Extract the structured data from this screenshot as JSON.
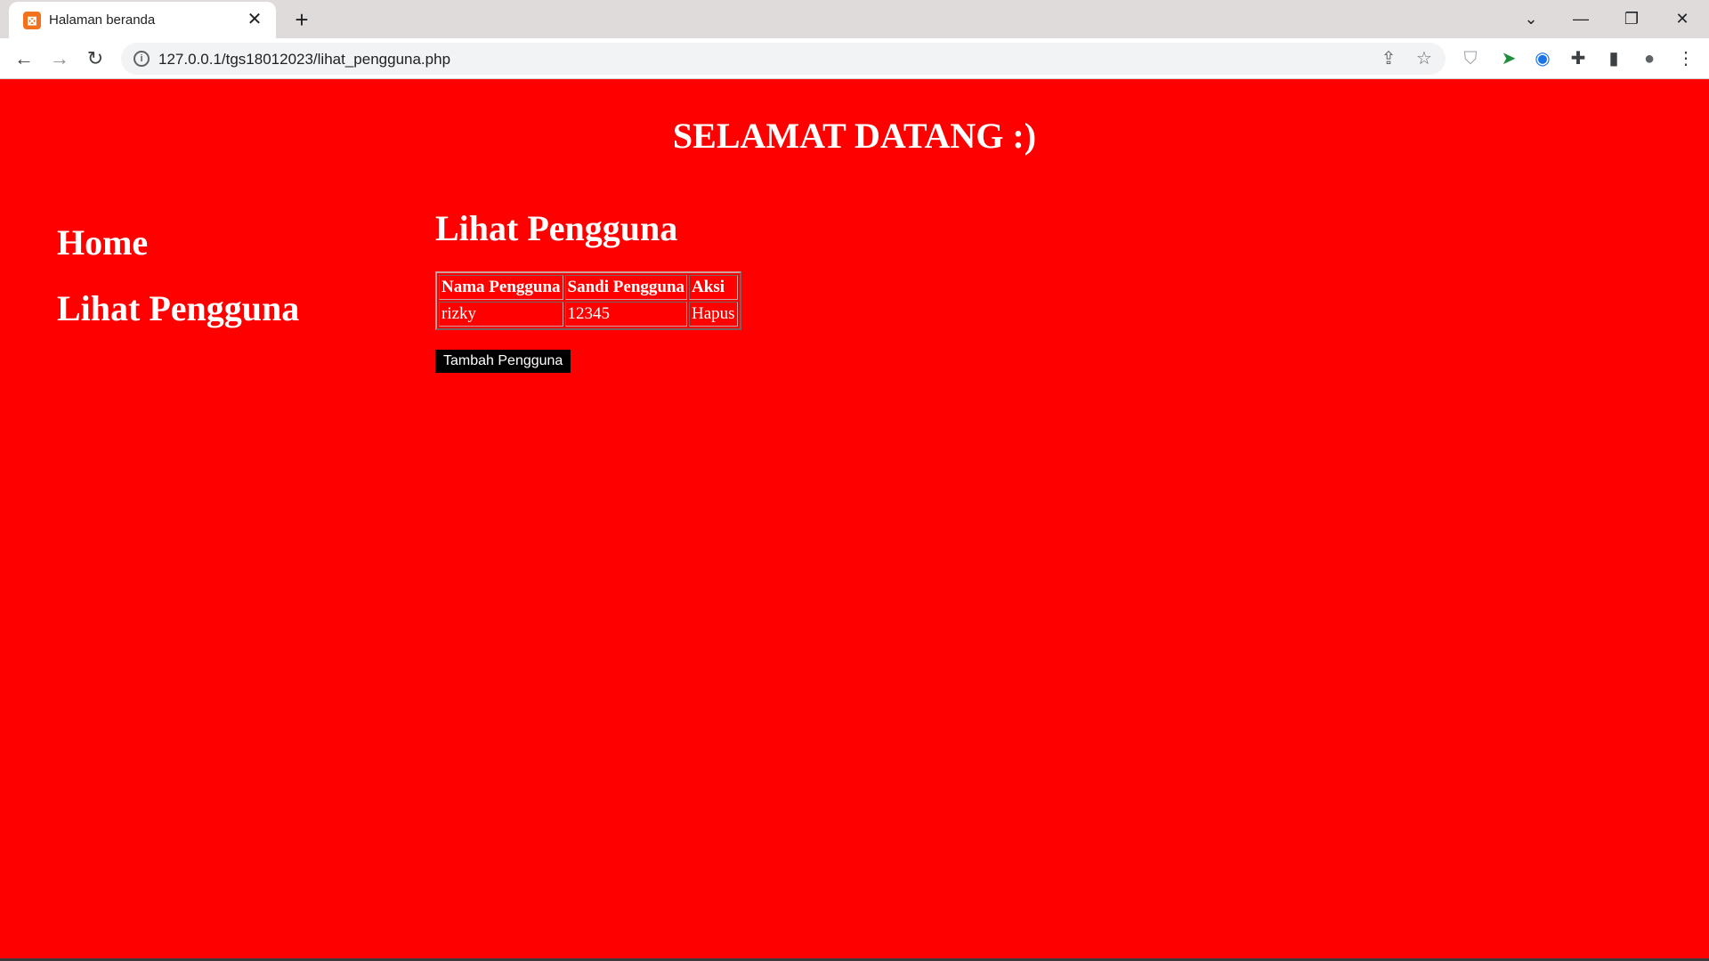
{
  "browser": {
    "tab_title": "Halaman beranda",
    "tab_close": "✕",
    "new_tab": "+",
    "url": "127.0.0.1/tgs18012023/lihat_pengguna.php",
    "window_controls": {
      "dropdown": "⌄",
      "minimize": "—",
      "restore": "❐",
      "close": "✕"
    },
    "icons": [
      "back-arrow-icon",
      "forward-arrow-icon",
      "reload-icon",
      "info-icon",
      "share-icon",
      "star-icon",
      "shield-extension-icon",
      "extension-on-icon",
      "edge-extension-icon",
      "puzzle-icon",
      "sidebar-icon",
      "profile-avatar",
      "menu-dots-icon"
    ]
  },
  "page": {
    "welcome": "SELAMAT DATANG :)",
    "sidebar": {
      "items": [
        {
          "label": "Home"
        },
        {
          "label": "Lihat Pengguna"
        }
      ]
    },
    "main": {
      "title": "Lihat Pengguna",
      "table": {
        "headers": [
          "Nama Pengguna",
          "Sandi Pengguna",
          "Aksi"
        ],
        "rows": [
          [
            "rizky",
            "12345",
            "Hapus"
          ]
        ]
      },
      "add_button": "Tambah Pengguna"
    }
  },
  "colors": {
    "page_background": "#ff0000",
    "text": "#ffffff",
    "button_background": "#000000"
  }
}
